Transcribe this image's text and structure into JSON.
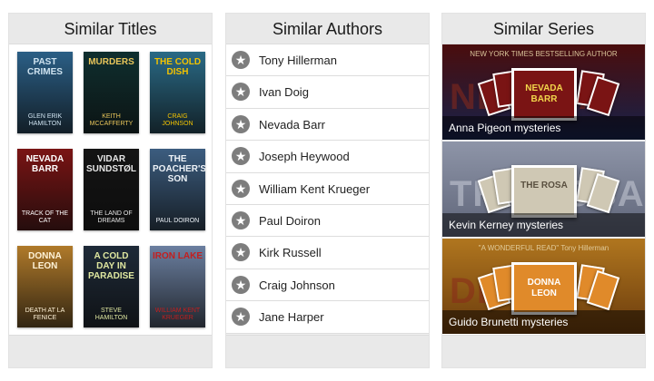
{
  "panels": {
    "titles": {
      "heading": "Similar Titles"
    },
    "authors": {
      "heading": "Similar Authors"
    },
    "series": {
      "heading": "Similar Series"
    }
  },
  "similar_titles": [
    {
      "title": "Past Crimes",
      "author": "Glen Erik Hamilton",
      "bg": "#2b5f86",
      "accent": "#cfe3f0"
    },
    {
      "title": "Murders",
      "author": "Keith McCafferty",
      "bg": "#0f2f2f",
      "accent": "#e8c55a"
    },
    {
      "title": "The Cold Dish",
      "author": "Craig Johnson",
      "bg": "#2a6a86",
      "accent": "#f2c200"
    },
    {
      "title": "Nevada Barr",
      "author": "Track of the Cat",
      "bg": "#7a1414",
      "accent": "#ffffff"
    },
    {
      "title": "Vidar Sundstøl",
      "author": "The Land of Dreams",
      "bg": "#141414",
      "accent": "#e6e6e6"
    },
    {
      "title": "The Poacher's Son",
      "author": "Paul Doiron",
      "bg": "#3c5d80",
      "accent": "#eef3f8"
    },
    {
      "title": "Donna Leon",
      "author": "Death at La Fenice",
      "bg": "#b07a2a",
      "accent": "#fff2d6"
    },
    {
      "title": "A Cold Day in Paradise",
      "author": "Steve Hamilton",
      "bg": "#1e2a38",
      "accent": "#dfe7a0"
    },
    {
      "title": "Iron Lake",
      "author": "William Kent Krueger",
      "bg": "#6b7fa0",
      "accent": "#c41e1e"
    }
  ],
  "similar_authors": [
    "Tony Hillerman",
    "Ivan Doig",
    "Nevada Barr",
    "Joseph Heywood",
    "William Kent Krueger",
    "Paul Doiron",
    "Kirk Russell",
    "Craig Johnson",
    "Jane Harper"
  ],
  "similar_series": [
    {
      "label": "Anna Pigeon mysteries",
      "bigword": "NEVADA",
      "topline": "NEW YORK TIMES BESTSELLING AUTHOR",
      "front_title": "NEVADA BARR",
      "bg1": "#4a0d0d",
      "bg2": "#16224a",
      "front_bg": "#7a1414",
      "front_color": "#f2d64b"
    },
    {
      "label": "Kevin Kerney mysteries",
      "bigword": "THE ROSA",
      "topline": "",
      "front_title": "THE ROSA",
      "bg1": "#8e95a8",
      "bg2": "#5e6478",
      "front_bg": "#cfc8b4",
      "front_color": "#5a5040"
    },
    {
      "label": "Guido Brunetti mysteries",
      "bigword": "DEATH",
      "topline": "\"A WONDERFUL READ\" Tony Hillerman",
      "front_title": "DONNA LEON",
      "bg1": "#b0761f",
      "bg2": "#6a3b0c",
      "front_bg": "#e08a2a",
      "front_color": "#ffffff"
    }
  ],
  "icons": {
    "author_badge": "star-icon"
  }
}
